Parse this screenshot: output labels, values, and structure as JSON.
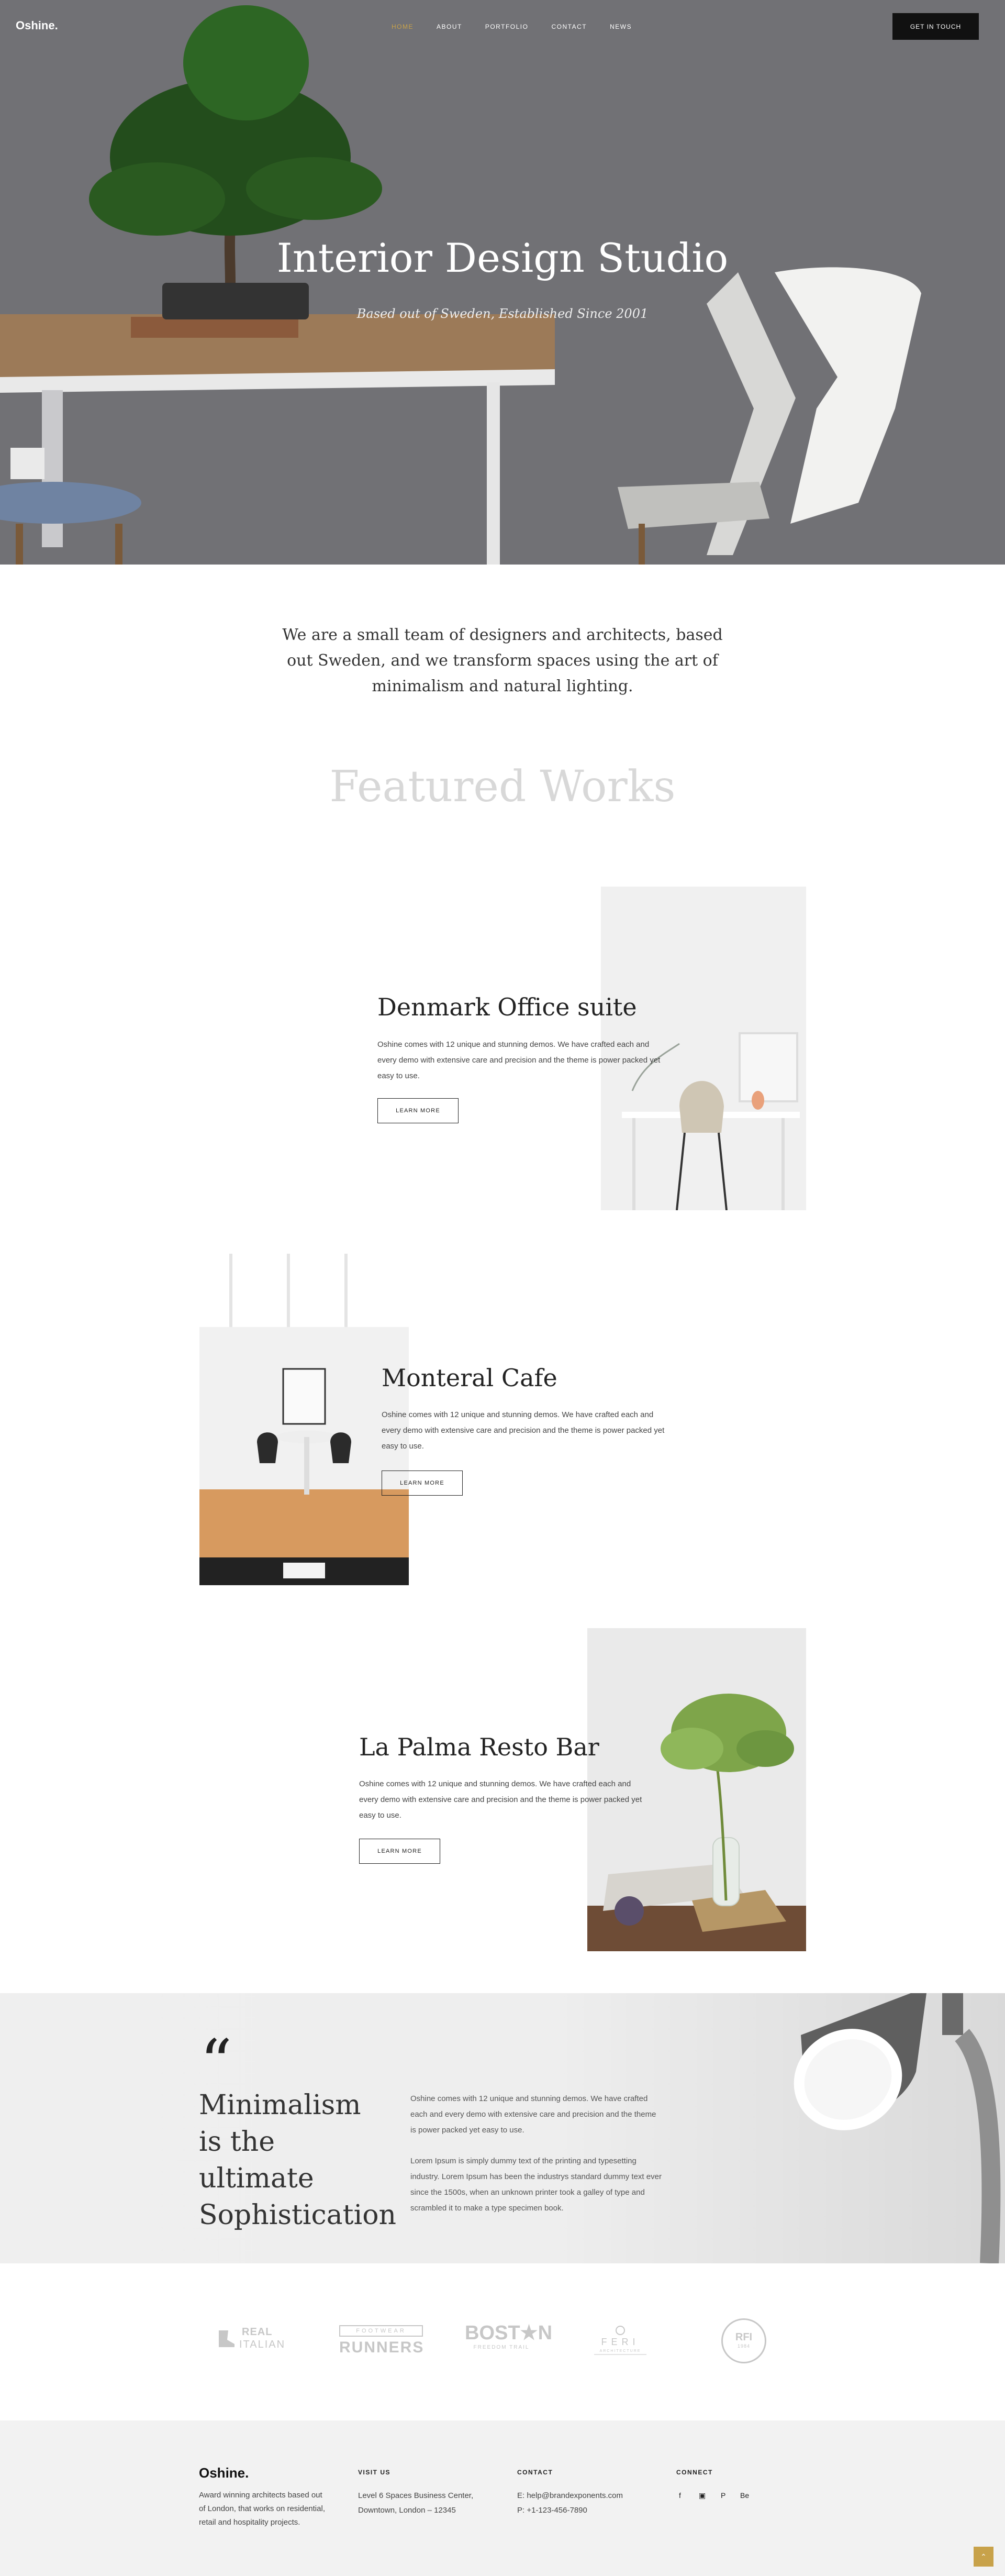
{
  "brand": {
    "logo": "Oshine.",
    "accent": "#c8a24a"
  },
  "nav": {
    "items": [
      "HOME",
      "ABOUT",
      "PORTFOLIO",
      "CONTACT",
      "NEWS"
    ],
    "active": 0,
    "cta": "GET IN TOUCH"
  },
  "hero": {
    "title": "Interior Design Studio",
    "subtitle": "Based out of Sweden, Established Since 2001"
  },
  "intro": {
    "text": "We are a small team of designers and architects, based out Sweden, and we transform spaces using the art of minimalism and natural lighting."
  },
  "featured": {
    "heading": "Featured Works"
  },
  "works": [
    {
      "title": "Denmark Office suite",
      "desc": "Oshine comes with 12 unique and stunning demos. We have crafted each and every demo with extensive care and precision and the theme is power packed yet easy to use.",
      "button": "LEARN MORE"
    },
    {
      "title": "Monteral Cafe",
      "desc": "Oshine comes with 12 unique and stunning demos. We have crafted each and every demo with extensive care and precision and the theme is power packed yet easy to use.",
      "button": "LEARN MORE"
    },
    {
      "title": "La Palma Resto Bar",
      "desc": "Oshine comes with 12 unique and stunning demos. We have crafted each and every demo with extensive care and precision and the theme is power packed yet easy to use.",
      "button": "LEARN MORE"
    }
  ],
  "quote": {
    "mark": "“",
    "title": "Minimalism is the ultimate Sophistication",
    "p1": "Oshine comes with 12 unique and stunning demos. We have crafted each and every demo with extensive care and precision and the theme is power packed yet easy to use.",
    "p2": "Lorem Ipsum is simply dummy text of the printing and typesetting industry. Lorem Ipsum has been the industrys standard dummy text ever since the 1500s, when an unknown printer took a galley of type and scrambled it to make a type specimen book."
  },
  "clients": {
    "real_italian": {
      "line1": "REAL",
      "line2": "ITALIAN"
    },
    "runners": {
      "line1": "FOOTWEAR",
      "line2": "RUNNERS"
    },
    "boston": {
      "line1": "BOST★N",
      "line2": "FREEDOM TRAIL"
    },
    "feri": {
      "line1": "FERI",
      "line2": "ARCHITECTURE"
    },
    "rfi": {
      "line1": "RFI",
      "line2": "1984"
    }
  },
  "footer": {
    "logo": "Oshine.",
    "about": "Award winning architects based out of London, that works on residential, retail and hospitality projects.",
    "visit_head": "VISIT US",
    "visit_line1": "Level 6 Spaces Business Center,",
    "visit_line2": "Downtown, London – 12345",
    "contact_head": "CONTACT",
    "email": "E: help@brandexponents.com",
    "phone": "P: +1-123-456-7890",
    "connect_head": "CONNECT",
    "social": [
      "f",
      "▣",
      "P",
      "Be"
    ],
    "to_top": "⌃"
  },
  "icons": [
    "facebook-icon",
    "instagram-icon",
    "pinterest-icon",
    "behance-icon",
    "back-to-top-icon",
    "quote-icon"
  ]
}
